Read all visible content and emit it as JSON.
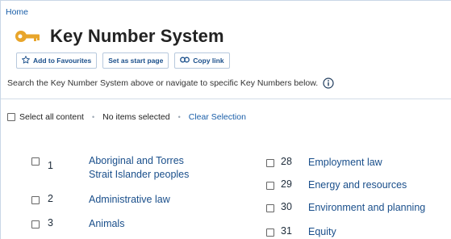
{
  "breadcrumb": "Home",
  "page_title": "Key Number System",
  "toolbar": {
    "favourites_label": "Add to Favourites",
    "start_page_label": "Set as start page",
    "copy_link_label": "Copy link"
  },
  "help_text": "Search the Key Number System above or navigate to specific Key Numbers below.",
  "selection": {
    "select_all_label": "Select all content",
    "status": "No items selected",
    "clear_label": "Clear Selection"
  },
  "topics": [
    {
      "number": "1",
      "label": "Aboriginal and Torres Strait Islander peoples",
      "label_line1": "Aboriginal and Torres",
      "label_line2": "Strait Islander peoples"
    },
    {
      "number": "2",
      "label": "Administrative law"
    },
    {
      "number": "3",
      "label": "Animals"
    },
    {
      "number": "28",
      "label": "Employment law"
    },
    {
      "number": "29",
      "label": "Energy and resources"
    },
    {
      "number": "30",
      "label": "Environment and planning"
    },
    {
      "number": "31",
      "label": "Equity"
    }
  ],
  "colors": {
    "link": "#1a5ea8",
    "title": "#222222",
    "key_icon": "#e8a52b"
  }
}
